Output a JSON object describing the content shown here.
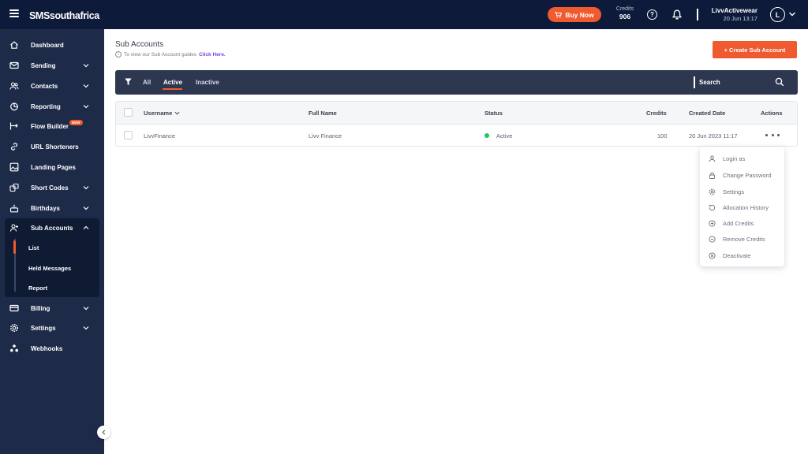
{
  "header": {
    "logo": "SMSsouthafrica",
    "buy_now": "Buy Now",
    "credits_label": "Credits",
    "credits_value": "906",
    "account_name": "LivvActivewear",
    "account_date": "20 Jun 13:17",
    "avatar_initial": "L"
  },
  "sidebar": {
    "items": [
      {
        "label": "Dashboard"
      },
      {
        "label": "Sending"
      },
      {
        "label": "Contacts"
      },
      {
        "label": "Reporting"
      },
      {
        "label": "Flow Builder",
        "badge": "NEW"
      },
      {
        "label": "URL Shorteners"
      },
      {
        "label": "Landing Pages"
      },
      {
        "label": "Short Codes"
      },
      {
        "label": "Birthdays"
      },
      {
        "label": "Sub Accounts"
      },
      {
        "label": "Billing"
      },
      {
        "label": "Settings"
      },
      {
        "label": "Webhooks"
      }
    ],
    "sub_items": [
      {
        "label": "List"
      },
      {
        "label": "Held Messages"
      },
      {
        "label": "Report"
      }
    ]
  },
  "page": {
    "title": "Sub Accounts",
    "guide_text": "To view our Sub Account guides",
    "guide_link": "Click Here.",
    "create_button": "+ Create Sub Account"
  },
  "filters": {
    "tabs": [
      {
        "label": "All"
      },
      {
        "label": "Active"
      },
      {
        "label": "Inactive"
      }
    ],
    "active_tab": "Active",
    "search_placeholder": "Search"
  },
  "table": {
    "columns": [
      "Username",
      "Full Name",
      "Status",
      "Credits",
      "Created Date",
      "Actions"
    ],
    "rows": [
      {
        "username": "LivvFinance",
        "full_name": "Livv Finance",
        "status": "Active",
        "credits": "100",
        "created": "20 Jun 2023 11:17"
      }
    ]
  },
  "actions_menu": {
    "items": [
      {
        "label": "Login as"
      },
      {
        "label": "Change Password"
      },
      {
        "label": "Settings"
      },
      {
        "label": "Allocation History"
      },
      {
        "label": "Add Credits"
      },
      {
        "label": "Remove Credits"
      },
      {
        "label": "Deactivate"
      }
    ]
  },
  "colors": {
    "topbar": "#0d1a3a",
    "sidebar": "#1d2a48",
    "accent": "#ef5a2f",
    "filterbar": "#2d3850",
    "status_active": "#22c55e",
    "link": "#7a3fe0"
  }
}
